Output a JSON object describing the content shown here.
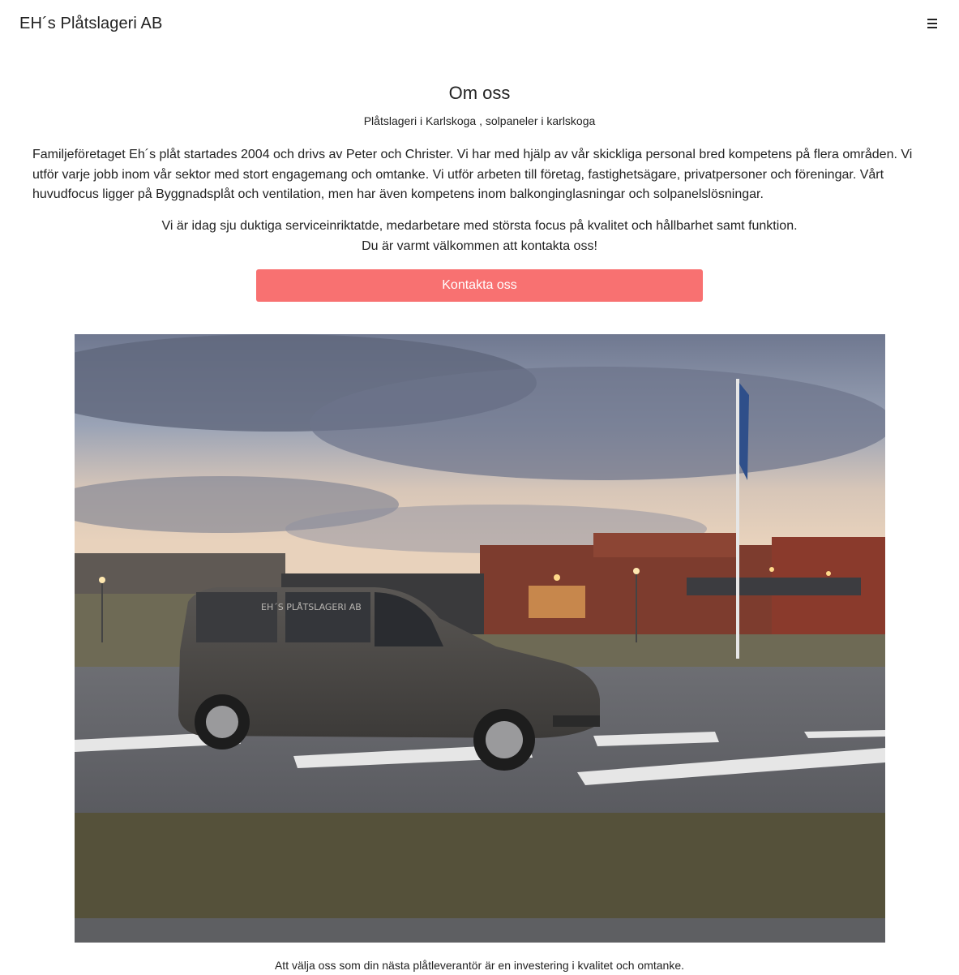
{
  "header": {
    "brand": "EH´s Plåtslageri AB",
    "menu_icon": "hamburger-menu-icon"
  },
  "about": {
    "title": "Om oss",
    "subtitle": "Plåtslageri i Karlskoga , solpaneler i karlskoga",
    "intro": "Familjeföretaget Eh´s plåt startades 2004 och drivs av Peter och Christer. Vi har med hjälp av vår skickliga personal bred kompetens på flera områden. Vi utför varje jobb inom vår sektor med stort engagemang och omtanke. Vi utför arbeten till företag, fastighetsägare, privatpersoner och föreningar. Vårt huvudfocus ligger på Byggnadsplåt och ventilation, men har även kompetens inom balkonginglasningar och solpanelslösningar.",
    "mission_line1": "Vi är idag sju duktiga serviceinriktatde, medarbetare med största focus på kvalitet och hållbarhet samt funktion.",
    "mission_line2": "Du är varmt välkommen att kontakta oss!",
    "cta_label": "Kontakta oss",
    "cta_color": "#f87171"
  },
  "photo": {
    "van_lettering": "EH´S PLÅTSLAGERI AB"
  },
  "caption": "Att välja oss som din nästa plåtleverantör är en investering i kvalitet och omtanke."
}
